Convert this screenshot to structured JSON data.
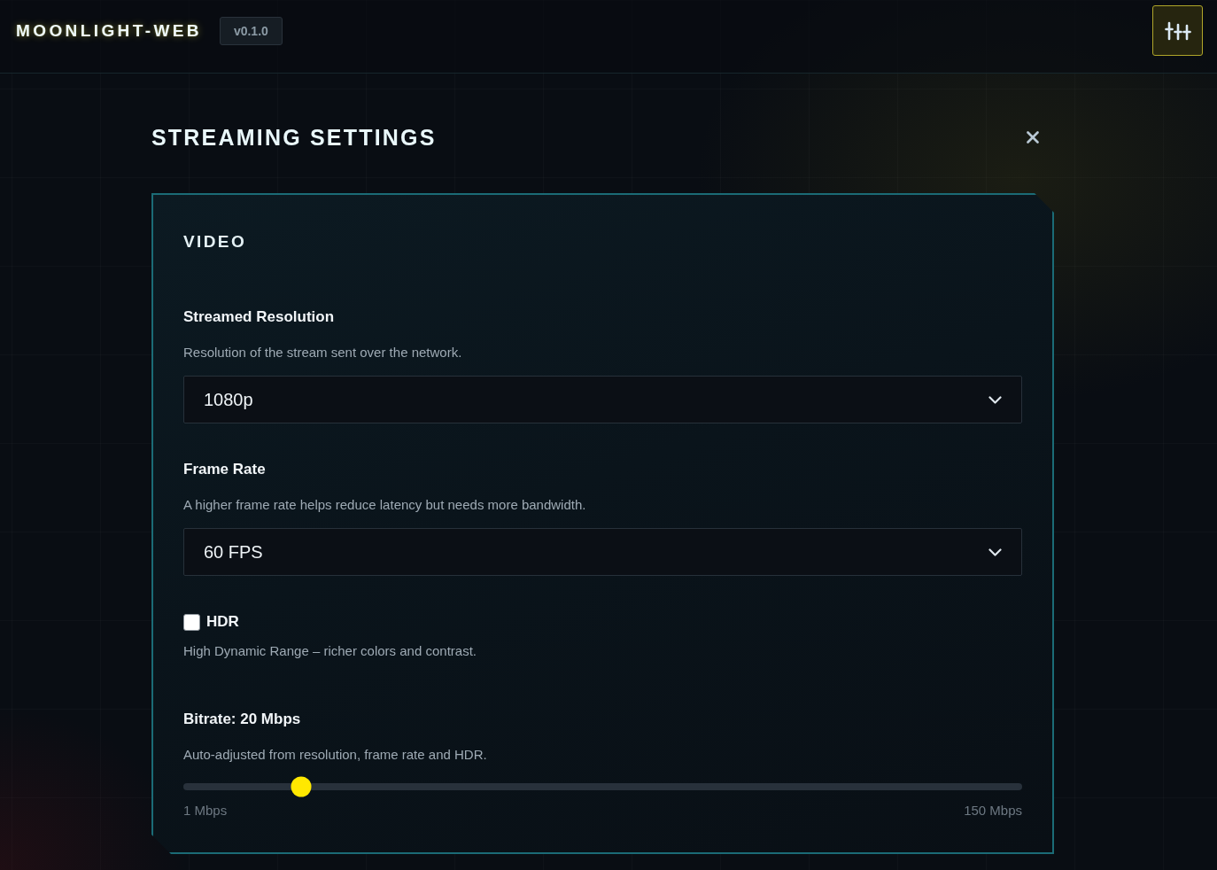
{
  "header": {
    "title": "MOONLIGHT-WEB",
    "version": "v0.1.0"
  },
  "dialog": {
    "title": "STREAMING SETTINGS",
    "sections": [
      {
        "title": "VIDEO",
        "fields": [
          {
            "kind": "select",
            "label": "Streamed Resolution",
            "description": "Resolution of the stream sent over the network.",
            "value": "1080p"
          },
          {
            "kind": "select",
            "label": "Frame Rate",
            "description": "A higher frame rate helps reduce latency but needs more bandwidth.",
            "value": "60 FPS"
          },
          {
            "kind": "checkbox",
            "label": "HDR",
            "checked": false,
            "description": "High Dynamic Range – richer colors and contrast."
          },
          {
            "kind": "slider",
            "label": "Bitrate: 20 Mbps",
            "description": "Auto-adjusted from resolution, frame rate and HDR.",
            "level": 0.14,
            "min_label": "1 Mbps",
            "max_label": "150 Mbps"
          }
        ]
      }
    ]
  }
}
